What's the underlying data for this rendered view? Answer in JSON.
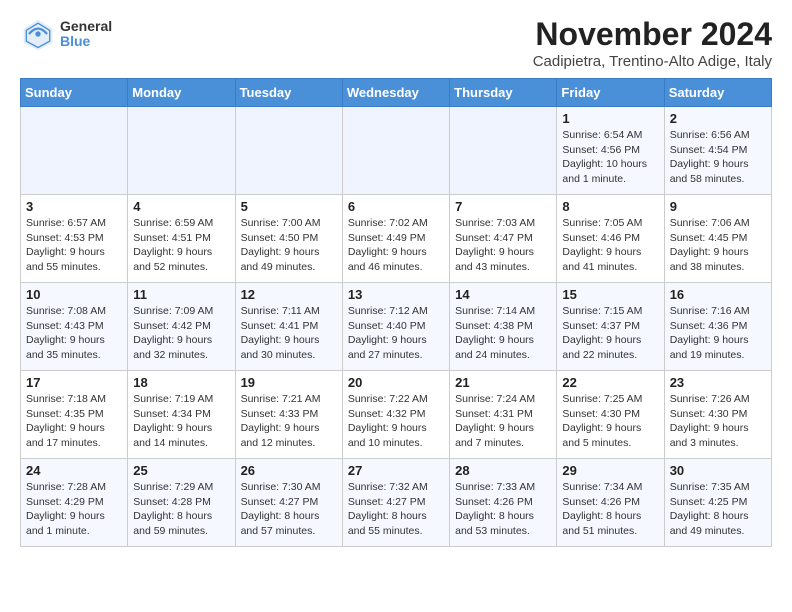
{
  "logo": {
    "general": "General",
    "blue": "Blue"
  },
  "header": {
    "month": "November 2024",
    "location": "Cadipietra, Trentino-Alto Adige, Italy"
  },
  "weekdays": [
    "Sunday",
    "Monday",
    "Tuesday",
    "Wednesday",
    "Thursday",
    "Friday",
    "Saturday"
  ],
  "rows": [
    {
      "cells": [
        {
          "day": "",
          "info": ""
        },
        {
          "day": "",
          "info": ""
        },
        {
          "day": "",
          "info": ""
        },
        {
          "day": "",
          "info": ""
        },
        {
          "day": "",
          "info": ""
        },
        {
          "day": "1",
          "info": "Sunrise: 6:54 AM\nSunset: 4:56 PM\nDaylight: 10 hours and 1 minute."
        },
        {
          "day": "2",
          "info": "Sunrise: 6:56 AM\nSunset: 4:54 PM\nDaylight: 9 hours and 58 minutes."
        }
      ]
    },
    {
      "cells": [
        {
          "day": "3",
          "info": "Sunrise: 6:57 AM\nSunset: 4:53 PM\nDaylight: 9 hours and 55 minutes."
        },
        {
          "day": "4",
          "info": "Sunrise: 6:59 AM\nSunset: 4:51 PM\nDaylight: 9 hours and 52 minutes."
        },
        {
          "day": "5",
          "info": "Sunrise: 7:00 AM\nSunset: 4:50 PM\nDaylight: 9 hours and 49 minutes."
        },
        {
          "day": "6",
          "info": "Sunrise: 7:02 AM\nSunset: 4:49 PM\nDaylight: 9 hours and 46 minutes."
        },
        {
          "day": "7",
          "info": "Sunrise: 7:03 AM\nSunset: 4:47 PM\nDaylight: 9 hours and 43 minutes."
        },
        {
          "day": "8",
          "info": "Sunrise: 7:05 AM\nSunset: 4:46 PM\nDaylight: 9 hours and 41 minutes."
        },
        {
          "day": "9",
          "info": "Sunrise: 7:06 AM\nSunset: 4:45 PM\nDaylight: 9 hours and 38 minutes."
        }
      ]
    },
    {
      "cells": [
        {
          "day": "10",
          "info": "Sunrise: 7:08 AM\nSunset: 4:43 PM\nDaylight: 9 hours and 35 minutes."
        },
        {
          "day": "11",
          "info": "Sunrise: 7:09 AM\nSunset: 4:42 PM\nDaylight: 9 hours and 32 minutes."
        },
        {
          "day": "12",
          "info": "Sunrise: 7:11 AM\nSunset: 4:41 PM\nDaylight: 9 hours and 30 minutes."
        },
        {
          "day": "13",
          "info": "Sunrise: 7:12 AM\nSunset: 4:40 PM\nDaylight: 9 hours and 27 minutes."
        },
        {
          "day": "14",
          "info": "Sunrise: 7:14 AM\nSunset: 4:38 PM\nDaylight: 9 hours and 24 minutes."
        },
        {
          "day": "15",
          "info": "Sunrise: 7:15 AM\nSunset: 4:37 PM\nDaylight: 9 hours and 22 minutes."
        },
        {
          "day": "16",
          "info": "Sunrise: 7:16 AM\nSunset: 4:36 PM\nDaylight: 9 hours and 19 minutes."
        }
      ]
    },
    {
      "cells": [
        {
          "day": "17",
          "info": "Sunrise: 7:18 AM\nSunset: 4:35 PM\nDaylight: 9 hours and 17 minutes."
        },
        {
          "day": "18",
          "info": "Sunrise: 7:19 AM\nSunset: 4:34 PM\nDaylight: 9 hours and 14 minutes."
        },
        {
          "day": "19",
          "info": "Sunrise: 7:21 AM\nSunset: 4:33 PM\nDaylight: 9 hours and 12 minutes."
        },
        {
          "day": "20",
          "info": "Sunrise: 7:22 AM\nSunset: 4:32 PM\nDaylight: 9 hours and 10 minutes."
        },
        {
          "day": "21",
          "info": "Sunrise: 7:24 AM\nSunset: 4:31 PM\nDaylight: 9 hours and 7 minutes."
        },
        {
          "day": "22",
          "info": "Sunrise: 7:25 AM\nSunset: 4:30 PM\nDaylight: 9 hours and 5 minutes."
        },
        {
          "day": "23",
          "info": "Sunrise: 7:26 AM\nSunset: 4:30 PM\nDaylight: 9 hours and 3 minutes."
        }
      ]
    },
    {
      "cells": [
        {
          "day": "24",
          "info": "Sunrise: 7:28 AM\nSunset: 4:29 PM\nDaylight: 9 hours and 1 minute."
        },
        {
          "day": "25",
          "info": "Sunrise: 7:29 AM\nSunset: 4:28 PM\nDaylight: 8 hours and 59 minutes."
        },
        {
          "day": "26",
          "info": "Sunrise: 7:30 AM\nSunset: 4:27 PM\nDaylight: 8 hours and 57 minutes."
        },
        {
          "day": "27",
          "info": "Sunrise: 7:32 AM\nSunset: 4:27 PM\nDaylight: 8 hours and 55 minutes."
        },
        {
          "day": "28",
          "info": "Sunrise: 7:33 AM\nSunset: 4:26 PM\nDaylight: 8 hours and 53 minutes."
        },
        {
          "day": "29",
          "info": "Sunrise: 7:34 AM\nSunset: 4:26 PM\nDaylight: 8 hours and 51 minutes."
        },
        {
          "day": "30",
          "info": "Sunrise: 7:35 AM\nSunset: 4:25 PM\nDaylight: 8 hours and 49 minutes."
        }
      ]
    }
  ]
}
